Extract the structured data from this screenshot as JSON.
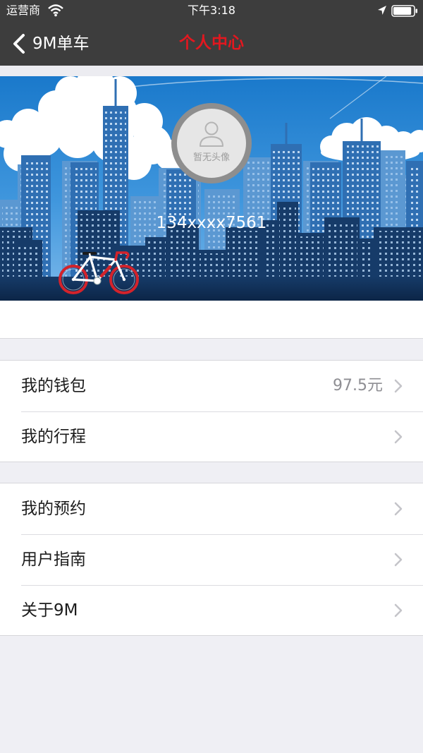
{
  "status_bar": {
    "carrier": "运营商",
    "time": "下午3:18",
    "battery_level": 0.9
  },
  "nav": {
    "back_label": "9M单车",
    "title": "个人中心"
  },
  "profile": {
    "avatar_placeholder": "暂无头像",
    "phone": "134xxxx7561"
  },
  "menu": {
    "groups": [
      {
        "items": [
          {
            "label": "我的钱包",
            "value": "97.5元"
          },
          {
            "label": "我的行程"
          }
        ]
      },
      {
        "items": [
          {
            "label": "我的预约"
          },
          {
            "label": "用户指南"
          },
          {
            "label": "关于9M"
          }
        ]
      }
    ]
  },
  "icons": {
    "status": [
      "wifi-icon",
      "location-arrow-icon",
      "battery-icon"
    ],
    "nav_back": "back-chevron-icon",
    "avatar": "avatar-placeholder-icon",
    "row_disclosure": "chevron-right-icon"
  },
  "colors": {
    "title_red": "#e3171f",
    "bar_background": "#3d3d3d",
    "page_background": "#efeff4",
    "bike_red": "#d3232b"
  }
}
